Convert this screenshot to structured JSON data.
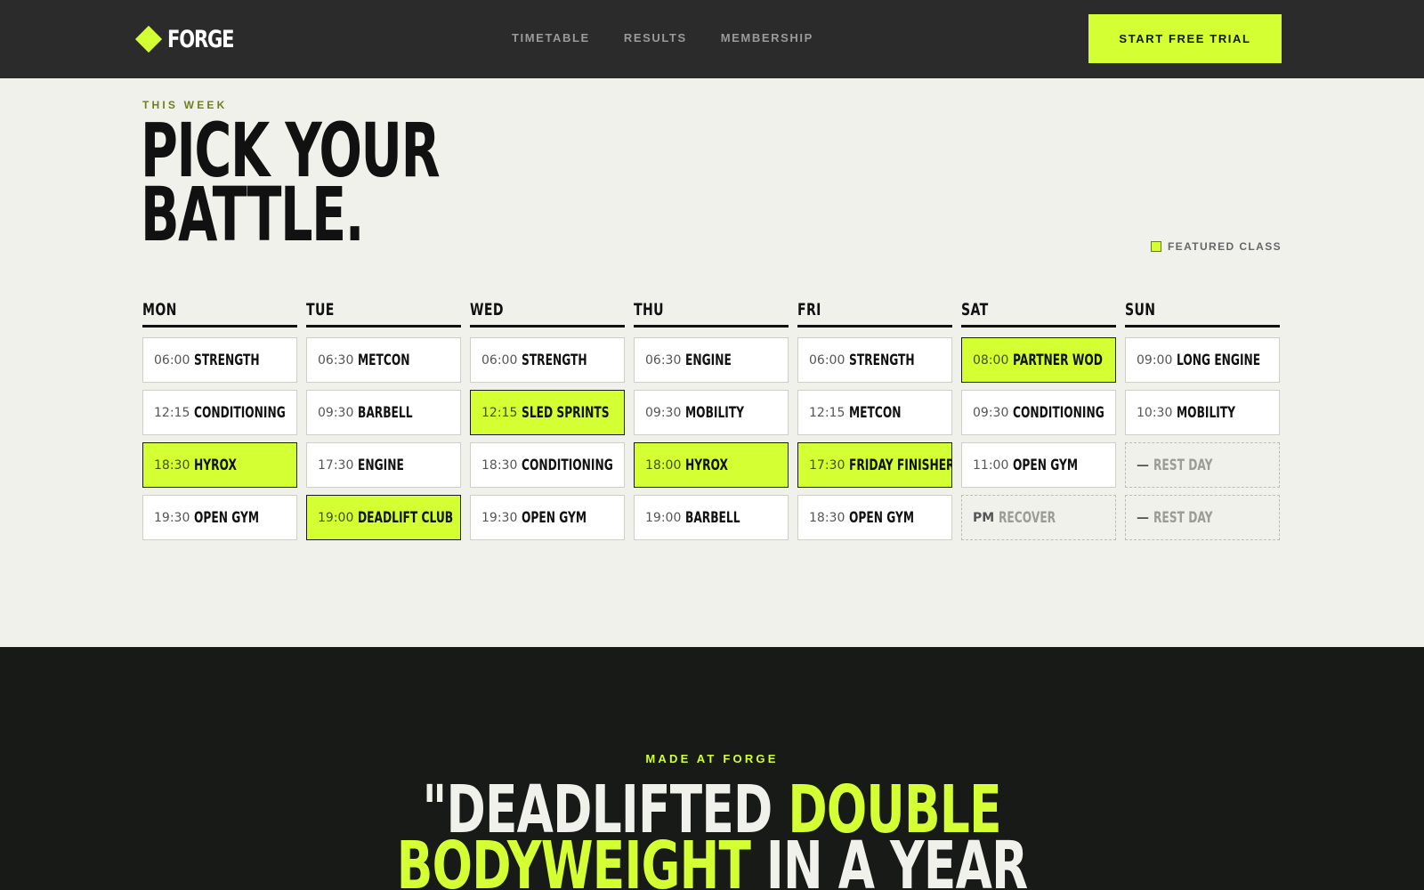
{
  "header": {
    "logo_text": "FORGE",
    "nav": [
      "TIMETABLE",
      "RESULTS",
      "MEMBERSHIP"
    ],
    "cta_label": "START FREE TRIAL"
  },
  "hero": {
    "eyebrow": "THIS WEEK",
    "headline_line1": "PICK YOUR",
    "headline_line2": "BATTLE.",
    "legend_label": "FEATURED CLASS"
  },
  "timetable": {
    "days": [
      {
        "name": "MON",
        "slots": [
          {
            "time": "06:00",
            "name": "STRENGTH",
            "kind": "normal"
          },
          {
            "time": "12:15",
            "name": "CONDITIONING",
            "kind": "normal"
          },
          {
            "time": "18:30",
            "name": "HYROX",
            "kind": "featured"
          },
          {
            "time": "19:30",
            "name": "OPEN GYM",
            "kind": "normal"
          }
        ]
      },
      {
        "name": "TUE",
        "slots": [
          {
            "time": "06:30",
            "name": "METCON",
            "kind": "normal"
          },
          {
            "time": "09:30",
            "name": "BARBELL",
            "kind": "normal"
          },
          {
            "time": "17:30",
            "name": "ENGINE",
            "kind": "normal"
          },
          {
            "time": "19:00",
            "name": "DEADLIFT CLUB",
            "kind": "featured"
          }
        ]
      },
      {
        "name": "WED",
        "slots": [
          {
            "time": "06:00",
            "name": "STRENGTH",
            "kind": "normal"
          },
          {
            "time": "12:15",
            "name": "SLED SPRINTS",
            "kind": "featured"
          },
          {
            "time": "18:30",
            "name": "CONDITIONING",
            "kind": "normal"
          },
          {
            "time": "19:30",
            "name": "OPEN GYM",
            "kind": "normal"
          }
        ]
      },
      {
        "name": "THU",
        "slots": [
          {
            "time": "06:30",
            "name": "ENGINE",
            "kind": "normal"
          },
          {
            "time": "09:30",
            "name": "MOBILITY",
            "kind": "normal"
          },
          {
            "time": "18:00",
            "name": "HYROX",
            "kind": "featured"
          },
          {
            "time": "19:00",
            "name": "BARBELL",
            "kind": "normal"
          }
        ]
      },
      {
        "name": "FRI",
        "slots": [
          {
            "time": "06:00",
            "name": "STRENGTH",
            "kind": "normal"
          },
          {
            "time": "12:15",
            "name": "METCON",
            "kind": "normal"
          },
          {
            "time": "17:30",
            "name": "FRIDAY FINISHER",
            "kind": "featured"
          },
          {
            "time": "18:30",
            "name": "OPEN GYM",
            "kind": "normal"
          }
        ]
      },
      {
        "name": "SAT",
        "slots": [
          {
            "time": "08:00",
            "name": "PARTNER WOD",
            "kind": "featured"
          },
          {
            "time": "09:30",
            "name": "CONDITIONING",
            "kind": "normal"
          },
          {
            "time": "11:00",
            "name": "OPEN GYM",
            "kind": "normal"
          },
          {
            "time": "PM",
            "name": "RECOVER",
            "kind": "rest"
          }
        ]
      },
      {
        "name": "SUN",
        "slots": [
          {
            "time": "09:00",
            "name": "LONG ENGINE",
            "kind": "normal"
          },
          {
            "time": "10:30",
            "name": "MOBILITY",
            "kind": "normal"
          },
          {
            "time": "—",
            "name": "REST DAY",
            "kind": "rest"
          },
          {
            "time": "—",
            "name": "REST DAY",
            "kind": "rest"
          }
        ]
      }
    ]
  },
  "testimonial": {
    "eyebrow": "MADE AT FORGE",
    "line1_a": "\"DEADLIFTED ",
    "line1_b": "DOUBLE",
    "line2_a": "BODYWEIGHT",
    "line2_b": " IN A YEAR"
  },
  "colors": {
    "accent": "#d4ff33",
    "header_bg": "#2b2b2b",
    "page_bg": "#f1f1ec",
    "dark_bg": "#181a18"
  },
  "icons": {
    "logo_mark": "diamond-icon"
  }
}
